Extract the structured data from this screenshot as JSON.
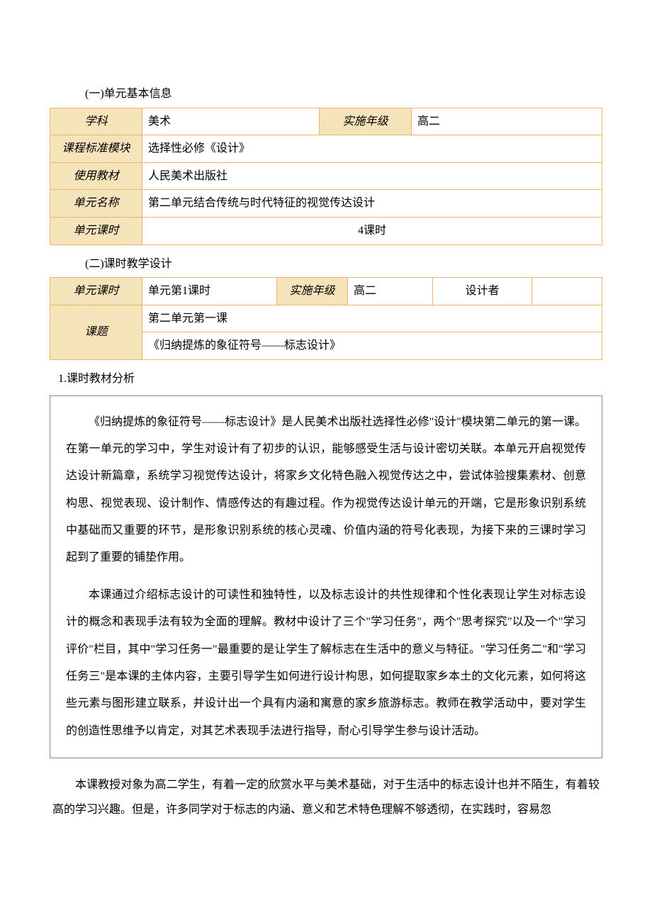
{
  "section1_title": "(一)单元基本信息",
  "table1": {
    "subject_label": "学科",
    "subject": "美术",
    "grade_label": "实施年级",
    "grade": "高二",
    "module_label": "课程标准模块",
    "module": "选择性必修《设计》",
    "textbook_label": "使用教材",
    "textbook": "人民美术出版社",
    "unitname_label": "单元名称",
    "unitname": "第二单元结合传统与时代特征的视觉传达设计",
    "unithours_label": "单元课时",
    "unithours": "4课时"
  },
  "section2_title": "(二)课时教学设计",
  "table2": {
    "unithours_label": "单元课时",
    "unithours": "单元第1课时",
    "grade_label": "实施年级",
    "grade": "高二",
    "designer_label": "设计者",
    "designer": "",
    "topic_label": "课题",
    "topic_line1": "第二单元第一课",
    "topic_line2": "《归纳提炼的象征符号——标志设计》"
  },
  "analysis_heading": "1.课时教材分析",
  "para1": "《归纳提炼的象征符号——标志设计》是人民美术出版社选择性必修\"设计\"模块第二单元的第一课。在第一单元的学习中，学生对设计有了初步的认识，能够感受生活与设计密切关联。本单元开启视觉传达设计新篇章，系统学习视觉传达设计，将家乡文化特色融入视觉传达之中，尝试体验搜集素材、创意构思、视觉表现、设计制作、情感传达的有趣过程。作为视觉传达设计单元的开端，它是形象识别系统中基础而又重要的环节，是形象识别系统的核心灵魂、价值内涵的符号化表现，为接下来的三课时学习起到了重要的铺垫作用。",
  "para2": "本课通过介绍标志设计的可读性和独特性，以及标志设计的共性规律和个性化表现让学生对标志设计的概念和表现手法有较为全面的理解。教材中设计了三个\"学习任务\"，两个\"思考探究\"以及一个\"学习评价\"栏目，其中\"学习任务一\"最重要的是让学生了解标志在生活中的意义与特征。\"学习任务二\"和\"学习任务三\"是本课的主体内容，主要引导学生如何进行设计构思，如何提取家乡本土的文化元素，如何将这些元素与图形建立联系，并设计出一个具有内涵和寓意的家乡旅游标志。教师在教学活动中，要对学生的创造性思维予以肯定，对其艺术表现手法进行指导，耐心引导学生参与设计活动。",
  "para3": "本课教授对象为高二学生，有着一定的欣赏水平与美术基础，对于生活中的标志设计也并不陌生，有着较高的学习兴趣。但是，许多同学对于标志的内涵、意义和艺术特色理解不够透彻，在实践时，容易忽"
}
